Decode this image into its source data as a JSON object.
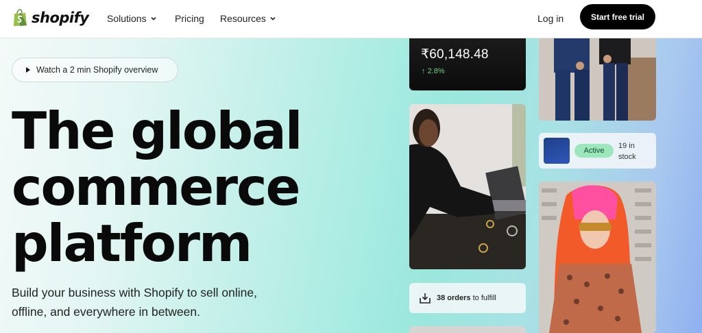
{
  "header": {
    "logo_text": "shopify",
    "nav": [
      {
        "label": "Solutions",
        "has_dropdown": true
      },
      {
        "label": "Pricing",
        "has_dropdown": false
      },
      {
        "label": "Resources",
        "has_dropdown": true
      }
    ],
    "login_label": "Log in",
    "cta_label": "Start free trial"
  },
  "hero": {
    "watch_label": "Watch a 2 min Shopify overview",
    "headline": [
      "The global",
      "commerce",
      "platform"
    ],
    "subtext": "Build your business with Shopify to sell online, offline, and everywhere in between."
  },
  "cards": {
    "sales_value": "₹60,148.48",
    "sales_change": "2.8%",
    "stock_status": "Active",
    "stock_count": "19 in stock",
    "orders_count": "38 orders",
    "orders_suffix": "to fulfill"
  },
  "colors": {
    "brand_green": "#95bf47",
    "cta_bg": "#000000",
    "active_badge": "#9de7bd",
    "positive_change": "#6fd38a"
  }
}
